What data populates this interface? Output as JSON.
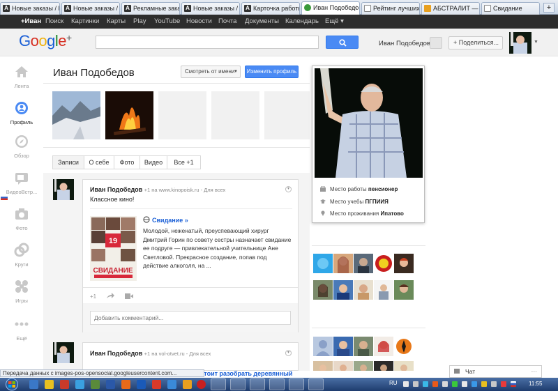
{
  "browser": {
    "tabs": [
      {
        "label": "Новые заказы / П..."
      },
      {
        "label": "Новые заказы / П..."
      },
      {
        "label": "Рекламные заказ..."
      },
      {
        "label": "Новые заказы / П..."
      },
      {
        "label": "Карточка работы ..."
      },
      {
        "label": "Иван Подобедо...",
        "active": true
      },
      {
        "label": "Рейтинг лучших п..."
      },
      {
        "label": "АБСТРАЛИТ — Ро..."
      },
      {
        "label": "Свидание"
      }
    ],
    "new_tab_label": "+",
    "status_text": "Передача данных с images-pos-opensocial.googleusercontent.com..."
  },
  "gbar": {
    "items": [
      "+Иван",
      "Поиск",
      "Картинки",
      "Карты",
      "Play",
      "YouTube",
      "Новости",
      "Почта",
      "Документы",
      "Календарь",
      "Ещё ▾"
    ]
  },
  "header": {
    "logo_text": "Google",
    "logo_plus": "+",
    "search_value": "",
    "user_name": "Иван Подобедов",
    "share_label": "+ Поделиться..."
  },
  "leftnav": {
    "items": [
      {
        "label": "Лента",
        "icon": "home-icon"
      },
      {
        "label": "Профиль",
        "icon": "profile-icon",
        "active": true
      },
      {
        "label": "Обзор",
        "icon": "explore-icon"
      },
      {
        "label": "ВидеоВстр...",
        "icon": "hangouts-icon"
      },
      {
        "label": "Фото",
        "icon": "camera-icon"
      },
      {
        "label": "Круги",
        "icon": "circles-icon"
      },
      {
        "label": "Игры",
        "icon": "games-icon"
      },
      {
        "label": "Ещё",
        "icon": "more-icon"
      }
    ]
  },
  "profile": {
    "name": "Иван Подобедов",
    "view_as_label": "Смотреть от имени",
    "edit_label": "Изменить профиль",
    "tabs": [
      "Записи",
      "О себе",
      "Фото",
      "Видео",
      "Все +1"
    ]
  },
  "hovercard": {
    "rows": [
      {
        "label": "Место работы",
        "value": "пенсионер",
        "icon": "work-icon"
      },
      {
        "label": "Место учебы",
        "value": "ПГПИИЯ",
        "icon": "education-icon"
      },
      {
        "label": "Место проживания",
        "value": "Ипатово",
        "icon": "location-icon"
      }
    ]
  },
  "posts": [
    {
      "author": "Иван Подобедов",
      "meta": "- +1 на www.kinopoisk.ru  -  Для всех",
      "text": "Классное кино!",
      "link_title": "Свидание »",
      "link_desc": "Молодой, неженатый, преуспевающий хирург Дмитрий Горин по совету сестры назначает свидание ее подруге — привлекательной учительнице Ане Светловой. Прекрасное создание, попав под действие алкоголя, на ...",
      "poster_text": "СВИДАНИЕ",
      "poster_date": "19",
      "plus_label": "+1",
      "comment_placeholder": "Добавить комментарий..."
    },
    {
      "author": "Иван Подобедов",
      "meta": "- +1 на vol-otvet.ru  -  Для всех",
      "link_title": "колько стоит разобрать деревянный"
    }
  ],
  "chat": {
    "label": "Чат"
  },
  "taskbar": {
    "lang": "RU",
    "clock": "11:55"
  }
}
